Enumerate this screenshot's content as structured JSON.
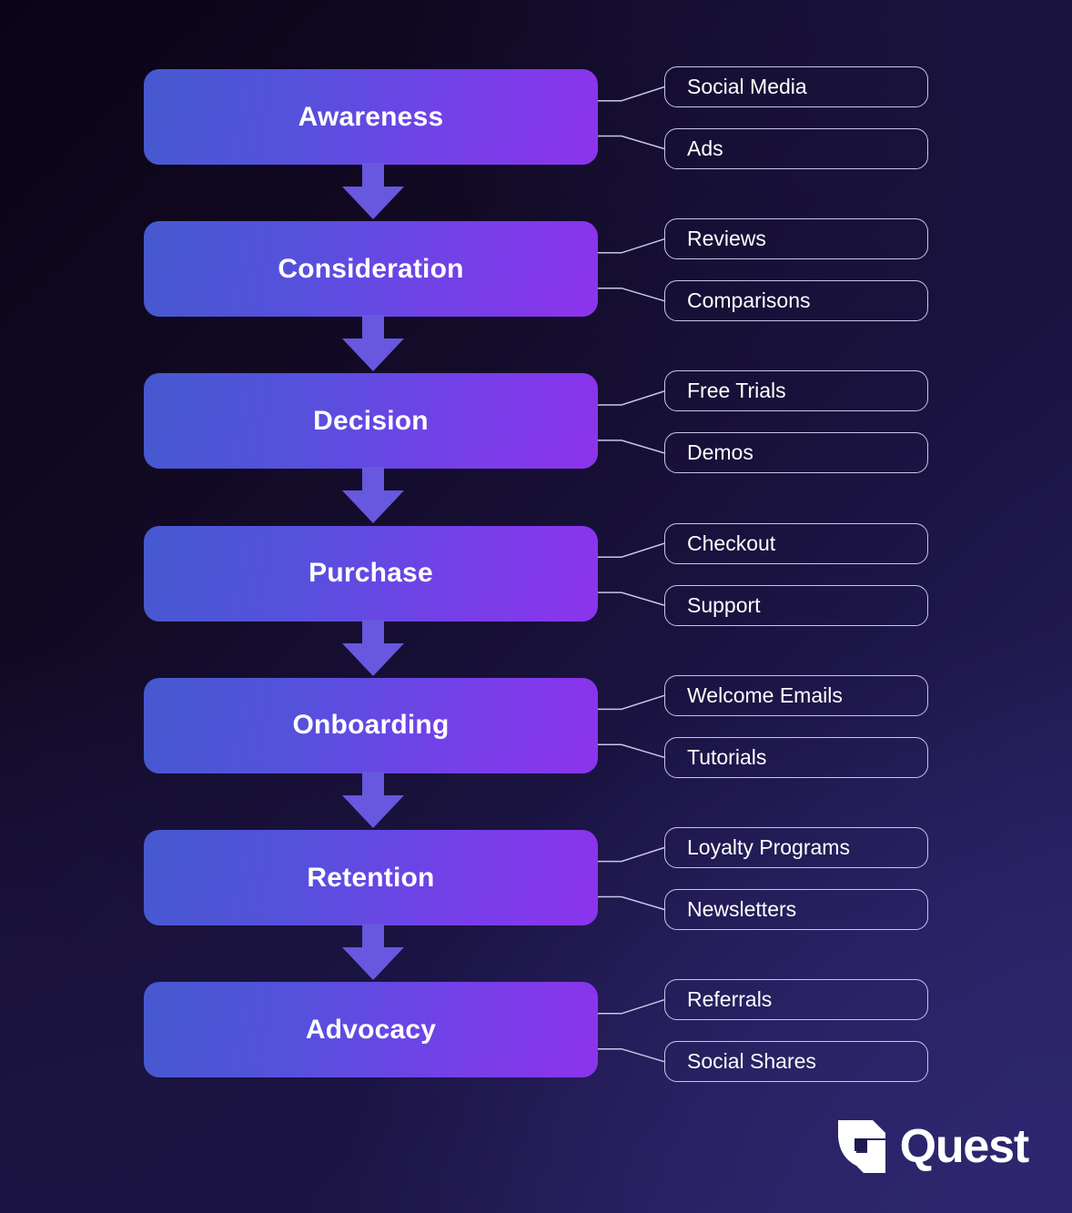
{
  "diagram": {
    "type": "customer-journey-funnel",
    "background": {
      "from": "#0B0416",
      "to": "#2A2363"
    },
    "bar": {
      "gradient_from": "#4659CF",
      "gradient_to": "#8C33EC"
    },
    "arrow_color": "#6857DF",
    "sub_item_border": "#C9C5EA",
    "stages": [
      {
        "label": "Awareness",
        "sub_items": [
          "Social Media",
          "Ads"
        ]
      },
      {
        "label": "Consideration",
        "sub_items": [
          "Reviews",
          "Comparisons"
        ]
      },
      {
        "label": "Decision",
        "sub_items": [
          "Free Trials",
          "Demos"
        ]
      },
      {
        "label": "Purchase",
        "sub_items": [
          "Checkout",
          "Support"
        ]
      },
      {
        "label": "Onboarding",
        "sub_items": [
          "Welcome Emails",
          "Tutorials"
        ]
      },
      {
        "label": "Retention",
        "sub_items": [
          "Loyalty Programs",
          "Newsletters"
        ]
      },
      {
        "label": "Advocacy",
        "sub_items": [
          "Referrals",
          "Social Shares"
        ]
      }
    ]
  },
  "brand": {
    "name": "Quest",
    "mark": "quest-shield-logo-icon",
    "color": "#FFFFFF"
  }
}
